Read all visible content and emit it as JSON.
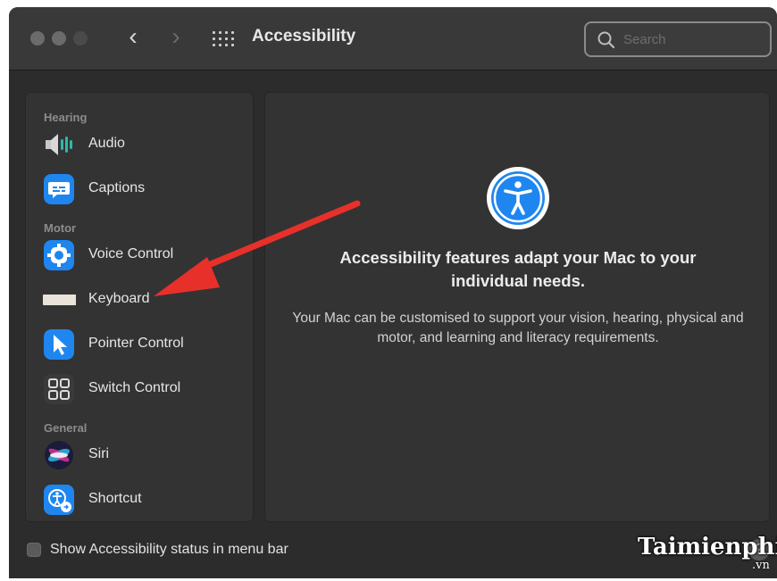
{
  "window": {
    "title": "Accessibility",
    "back_icon": "chevron-left-icon",
    "forward_icon": "chevron-right-icon",
    "back_glyph": "‹",
    "forward_glyph": "›",
    "traffic_light_colors": [
      "#6b6b6b",
      "#6b6b6b",
      "#4a4a4a"
    ]
  },
  "search": {
    "placeholder": "Search",
    "icon": "search-icon"
  },
  "sidebar": {
    "sections": [
      {
        "header": "Hearing",
        "items": [
          {
            "label": "Audio",
            "icon": "speaker-icon"
          },
          {
            "label": "Captions",
            "icon": "captions-icon"
          }
        ]
      },
      {
        "header": "Motor",
        "items": [
          {
            "label": "Voice Control",
            "icon": "voice-control-icon"
          },
          {
            "label": "Keyboard",
            "icon": "keyboard-icon"
          },
          {
            "label": "Pointer Control",
            "icon": "pointer-icon"
          },
          {
            "label": "Switch Control",
            "icon": "switch-control-icon"
          }
        ]
      },
      {
        "header": "General",
        "items": [
          {
            "label": "Siri",
            "icon": "siri-icon"
          },
          {
            "label": "Shortcut",
            "icon": "shortcut-icon"
          }
        ]
      }
    ]
  },
  "content": {
    "icon": "accessibility-icon",
    "headline": "Accessibility features adapt your Mac to your individual needs.",
    "body": "Your Mac can be customised to support your vision, hearing, physical and motor, and learning and literacy requirements."
  },
  "footer": {
    "checkbox_label": "Show Accessibility status in menu bar",
    "checkbox_checked": false,
    "help_label": "?"
  },
  "overlay": {
    "arrow_color": "#e8302a",
    "arrow_points_to": "Keyboard"
  },
  "watermark": {
    "text": "Taimienphi",
    "suffix": ".vn"
  },
  "colors": {
    "accent": "#0a84ff",
    "window_bg": "#2c2c2c",
    "panel_bg": "#333333"
  }
}
